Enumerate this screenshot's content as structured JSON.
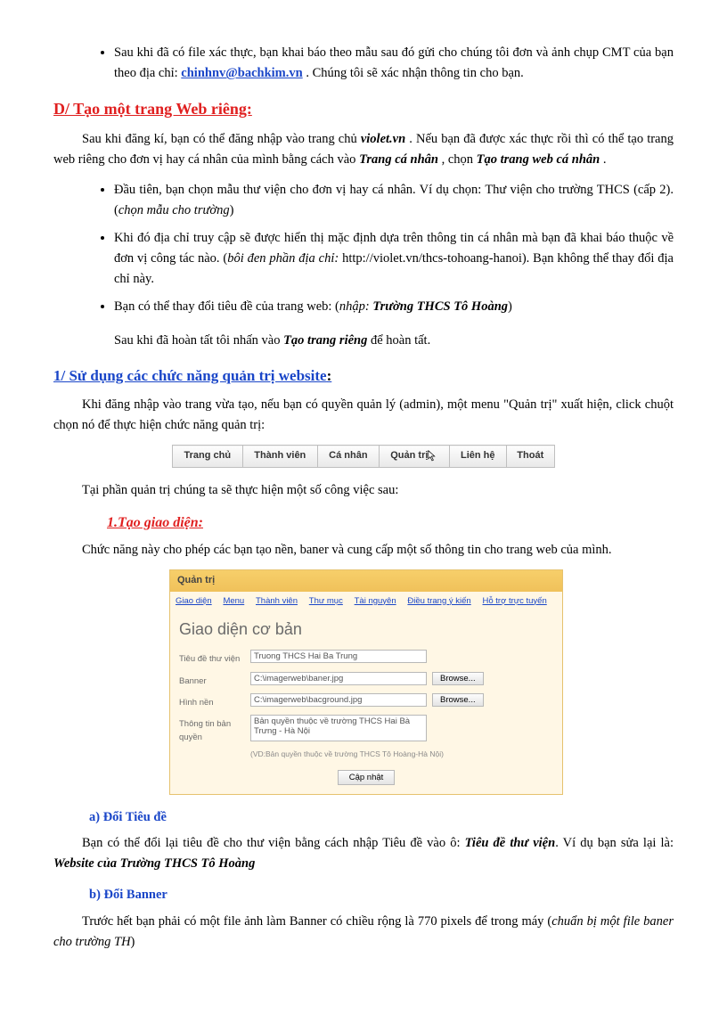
{
  "top_bullet": {
    "text_a": "Sau khi đã có file xác thực, bạn khai báo theo mẫu sau đó gửi cho chúng tôi đơn và ảnh chụp CMT của bạn theo địa chỉ: ",
    "email": "chinhnv@bachkim.vn",
    "text_b": " . Chúng tôi sẽ xác nhận thông tin cho bạn."
  },
  "h_d": "D/ Tạo một trang Web riêng:",
  "d_intro": {
    "a": "Sau khi đăng kí, bạn có thể đăng nhập vào trang chủ ",
    "violet": "violet.vn",
    "b": ". Nếu bạn đã được xác thực rồi thì có thể tạo trang web riêng cho đơn vị hay cá nhân của mình bằng cách vào ",
    "trang": "Trang cá nhân",
    "c": ", chọn ",
    "tao": "Tạo trang web cá nhân",
    "d": "."
  },
  "d_list": {
    "i1a": "Đầu tiên, bạn chọn mẫu thư viện cho đơn vị hay cá nhân. Ví dụ chọn: Thư viện cho trường THCS (cấp 2). (",
    "i1b": "chọn mẫu cho trường",
    "i1c": ")",
    "i2a": "Khi đó địa chỉ truy cập sẽ được hiển thị mặc định dựa trên thông tin cá nhân mà bạn đã khai báo thuộc về đơn vị công tác nào. (",
    "i2b": "bôi đen phần địa chỉ:",
    "i2c": " http://violet.vn/thcs-tohoang-hanoi). Bạn không thể thay đổi địa chỉ này.",
    "i3a": "Bạn có thể thay đổi tiêu đề của trang web: (",
    "i3b": "nhập:",
    "i3c": " ",
    "i3d": "Trường THCS Tô Hoàng",
    "i3e": ")",
    "i3_sub_a": "Sau khi đã hoàn tất tôi nhấn vào ",
    "i3_sub_b": "Tạo trang riêng",
    "i3_sub_c": " để hoàn tất."
  },
  "h_1": " 1/ Sử dụng các chức năng quản trị website",
  "h_1_colon": ":",
  "p1_text": "Khi đăng nhập vào trang vừa tạo, nếu bạn có quyền quản lý (admin), một menu \"Quản trị\" xuất hiện, click chuột chọn nó để thực hiện chức năng quản trị:",
  "menu": [
    "Trang chủ",
    "Thành viên",
    "Cá nhân",
    "Quản trị",
    "Liên hệ",
    "Thoát"
  ],
  "p2_text": "Tại phần quản trị chúng ta sẽ thực hiện một số công việc sau:",
  "h_1_1": "1.Tạo giao diện:",
  "p3_text": "Chức năng này cho phép các bạn tạo nền, baner và cung cấp một số thông tin cho trang web của mình.",
  "panel": {
    "title": "Quản trị",
    "tabs": [
      "Giao diện",
      "Menu",
      "Thành viên",
      "Thư mục",
      "Tài nguyên",
      "Điều trang ý kiến",
      "Hỗ trợ trực tuyến"
    ],
    "section": "Giao diện cơ bản",
    "rows": {
      "r1_label": "Tiêu đề thư viện",
      "r1_value": "Truong THCS Hai Ba Trung",
      "r2_label": "Banner",
      "r2_value": "C:\\imagerweb\\baner.jpg",
      "r3_label": "Hình nền",
      "r3_value": "C:\\imagerweb\\bacground.jpg",
      "r4_label": "Thông tin bản quyền",
      "r4_value": "Bản quyền thuộc về trường THCS Hai Bà Trưng - Hà Nội",
      "hint": "(VD:Bản quyền thuộc về trường THCS Tô Hoàng-Hà Nội)"
    },
    "browse": "Browse...",
    "update": "Cập nhật"
  },
  "sub_a": "a) Đổi Tiêu đề",
  "pa_text_a": "Bạn có thể đổi lại tiêu đề cho thư viện bằng cách nhập Tiêu đề vào ô: ",
  "pa_text_b": "Tiêu đề thư viện",
  "pa_text_c": ". Ví dụ bạn sửa lại là: ",
  "pa_text_d": "Website của Trường THCS Tô Hoàng",
  "sub_b": "b) Đổi Banner",
  "pb_text_a": "Trước hết bạn phải có một file ảnh làm Banner có chiều rộng là 770 pixels để trong máy (",
  "pb_text_b": "chuẩn bị một file baner cho trường TH",
  "pb_text_c": ")"
}
